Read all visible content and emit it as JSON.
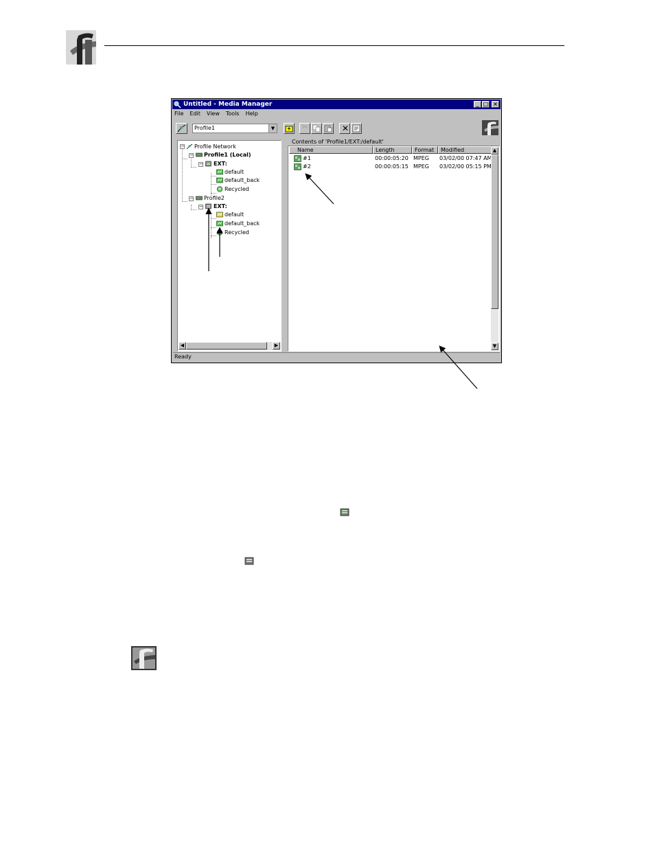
{
  "window": {
    "title": "Untitled - Media Manager",
    "menu": [
      "File",
      "Edit",
      "View",
      "Tools",
      "Help"
    ],
    "machine_combo": "Profile1",
    "contents_label": "Contents of 'Profile1/EXT:/default'",
    "status": "Ready"
  },
  "tree": {
    "network": "Profile Network",
    "profile1": "Profile1 (Local)",
    "profile1_ext": "EXT:",
    "profile1_bins": [
      "default",
      "default_back",
      "Recycled"
    ],
    "profile2": "Profile2",
    "profile2_ext": "EXT:",
    "profile2_bins": [
      "default",
      "default_back",
      "Recycled"
    ]
  },
  "list": {
    "columns": [
      "Name",
      "Length",
      "Format",
      "Modified"
    ],
    "rows": [
      {
        "name": "#1",
        "length": "00:00:05:20",
        "format": "MPEG",
        "modified": "03/02/00 07:47 AM"
      },
      {
        "name": "#2",
        "length": "00:00:05:15",
        "format": "MPEG",
        "modified": "03/02/00 05:15 PM"
      }
    ]
  },
  "icons": {
    "header_logo": "profile-logo-icon",
    "app": "media-manager-icon",
    "disk": "disk-icon",
    "bin": "bin-icon",
    "clip": "clip-icon",
    "recycle": "recycle-bin-icon"
  }
}
